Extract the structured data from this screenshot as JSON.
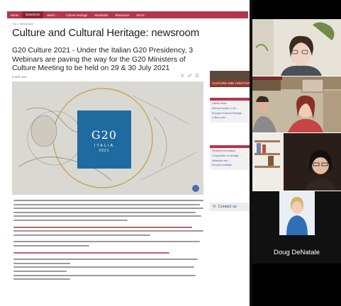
{
  "nav": {
    "items": [
      "Home",
      "Newsroom",
      "Work / ...",
      "Culture Heritage",
      "Standards",
      "Resources",
      "EEAS"
    ],
    "active_index": 1
  },
  "breadcrumb": "EU > Newsroom",
  "page_title": "Culture and Cultural Heritage: newsroom",
  "article": {
    "subtitle": "G20 Culture 2021 - Under the Italian G20 Presidency, 3 Webinars are paving the way for the G20 Ministers of Culture Meeting to be held on 29 & 30 July 2021",
    "date": "8 APR 2021",
    "hero_logo": {
      "main": "G20",
      "country": "ITALIA",
      "year": "2021"
    }
  },
  "sidebar": {
    "banner": "CULTURE AND CREATIVITY",
    "box1": {
      "title": "Latest news",
      "links": [
        "Moving Europe | Call ...",
        "Europe's Cultural Heritage ...",
        "Culture and ..."
      ]
    },
    "box2": {
      "title": "Related Information",
      "links": [
        "Cooperation of heritage ...",
        "Networks and ...",
        "Europe's heritage ..."
      ]
    },
    "contact": "Contact us"
  },
  "participants": [
    {
      "name": "",
      "bg": "#e7e2d6"
    },
    {
      "name": "",
      "bg": "#c9bca5"
    },
    {
      "name": "",
      "bg": "#cdbfb3"
    },
    {
      "name": "",
      "bg": "#8a6f5a"
    },
    {
      "name": "Doug DeNatale",
      "bg": "#3c78b8"
    }
  ],
  "colors": {
    "nav": "#b7354a",
    "g20_blue": "#1f6a9f"
  }
}
